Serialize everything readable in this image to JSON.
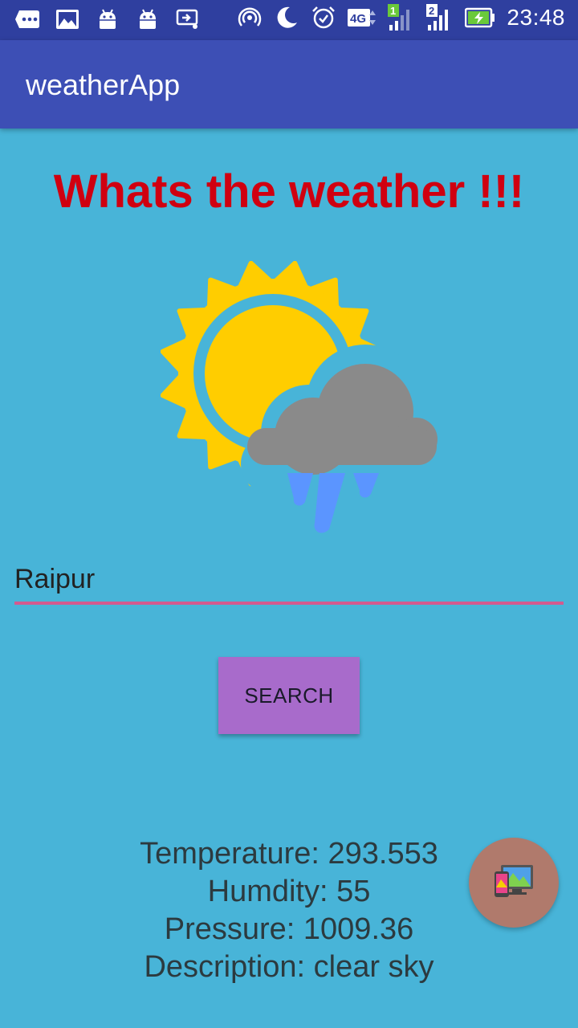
{
  "status_bar": {
    "time": "23:48",
    "network_type": "4G",
    "sim1_label": "1",
    "sim2_label": "2",
    "icons": [
      "more-icon",
      "image-icon",
      "android-icon",
      "android-icon",
      "cast-icon",
      "hotspot-icon",
      "moon-icon",
      "alarm-icon",
      "signal-icon",
      "signal-icon",
      "battery-charging-icon"
    ]
  },
  "app_bar": {
    "title": "weatherApp"
  },
  "main": {
    "headline": "Whats the weather !!!",
    "weather_icon": "sun-cloud-rain-icon",
    "city_input": {
      "value": "Raipur"
    },
    "search_button": {
      "label": "SEARCH"
    },
    "results": {
      "temperature": "Temperature: 293.553",
      "humidity": "Humdity: 55",
      "pressure": "Pressure: 1009.36",
      "description": "Description: clear sky"
    },
    "fab": {
      "icon": "devices-icon"
    }
  },
  "colors": {
    "status_bar": "#2f3f9f",
    "app_bar": "#3d4fb5",
    "background": "#48b4d8",
    "headline": "#d00010",
    "input_underline": "#d35a8f",
    "button": "#a86bcb",
    "fab": "#b07a6c"
  }
}
